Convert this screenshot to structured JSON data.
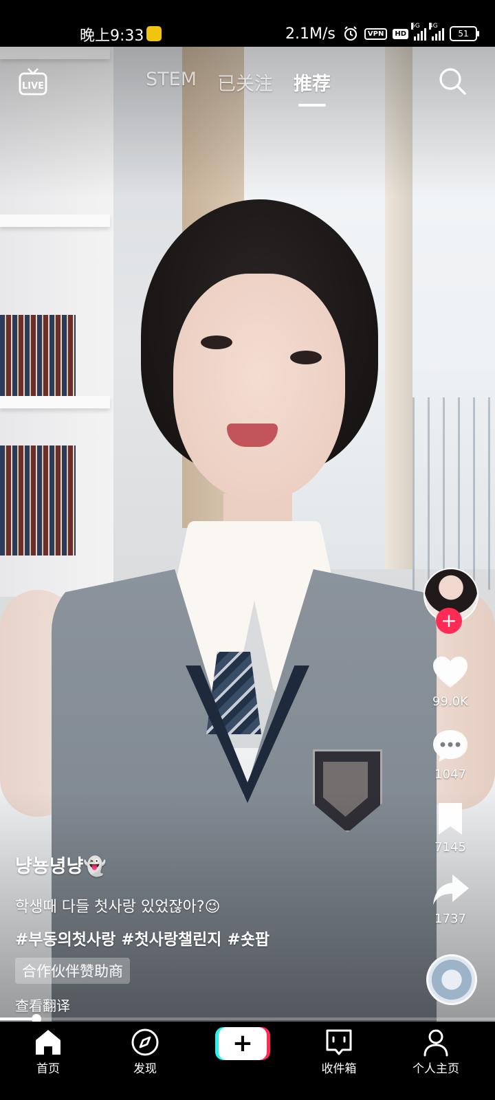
{
  "status_bar": {
    "time": "晚上9:33",
    "network_speed": "2.1M/s",
    "vpn_label": "VPN",
    "hd_label": "HD",
    "signal_1_tag": "5G",
    "signal_2_tag": "4G",
    "battery": "51",
    "icons": [
      "notification-badge-icon",
      "alarm-icon",
      "signal-icon",
      "battery-icon"
    ]
  },
  "top_nav": {
    "live_label": "LIVE",
    "tabs": [
      {
        "label": "STEM",
        "active": false
      },
      {
        "label": "已关注",
        "active": false
      },
      {
        "label": "推荐",
        "active": true
      }
    ],
    "search_icon": "search-icon"
  },
  "right_rail": {
    "follow_symbol": "+",
    "likes": "99.0K",
    "comments": "1047",
    "favorites": "7145",
    "shares": "1737",
    "icons": [
      "heart-icon",
      "comment-icon",
      "bookmark-icon",
      "share-icon",
      "music-disc-icon"
    ]
  },
  "caption": {
    "username": "냥뇽녕냥👻",
    "description": "학생때 다들 첫사랑 있었잖아?😉",
    "hashtags": "#부동의첫사랑 #첫사랑챌린지 #숏팝",
    "sponsor_tag": "合作伙伴赞助商",
    "translate_link": "查看翻译"
  },
  "playback": {
    "progress": 0.073
  },
  "bottom_nav": {
    "items": [
      {
        "label": "首页",
        "icon": "home-icon",
        "active": true
      },
      {
        "label": "发现",
        "icon": "compass-icon",
        "active": false
      },
      {
        "label": "+",
        "icon": "create-icon",
        "active": false
      },
      {
        "label": "收件箱",
        "icon": "inbox-icon",
        "active": false
      },
      {
        "label": "个人主页",
        "icon": "profile-icon",
        "active": false
      }
    ]
  },
  "colors": {
    "accent_pink": "#fe2c55",
    "accent_cyan": "#25f4ee",
    "background": "#000000",
    "text": "#ffffff"
  }
}
